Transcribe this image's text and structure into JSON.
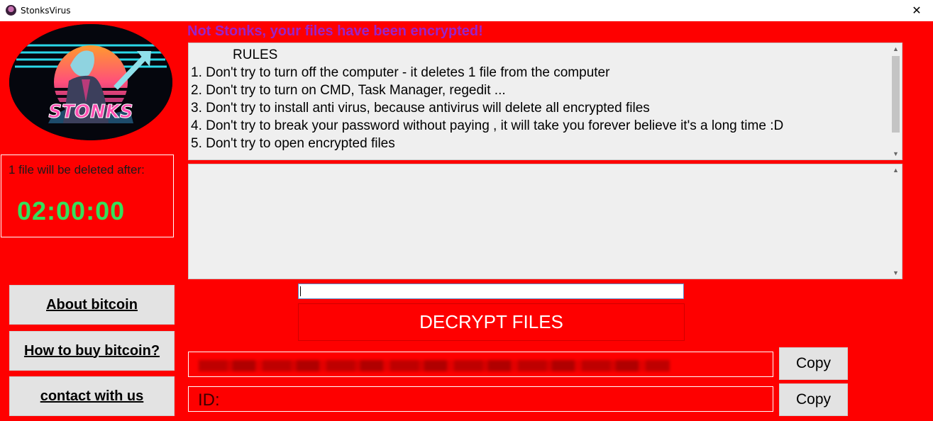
{
  "window": {
    "title": "StonksVirus",
    "close_glyph": "✕"
  },
  "logo": {
    "text": "STONKS",
    "icon": "stonks-logo"
  },
  "timer": {
    "label": "1 file will be deleted after:",
    "value": "02:00:00",
    "color": "#34e05a"
  },
  "sidebar": {
    "buttons": [
      {
        "label": "About bitcoin"
      },
      {
        "label": "How to buy bitcoin?"
      },
      {
        "label": "contact with us"
      }
    ]
  },
  "headline": "Not Stonks, your files have been encrypted!",
  "rules": {
    "title": "RULES",
    "items": [
      "1. Don't try to turn off the computer - it deletes 1 file from the computer",
      "2. Don't try to turn on CMD, Task Manager, regedit ...",
      "3. Don't try to install anti virus, because antivirus will delete all encrypted files",
      "4. Don't try to break your password without paying , it will take you forever believe it's a long time :D",
      "5. Don't try to open encrypted files"
    ]
  },
  "decrypt": {
    "button_label": "DECRYPT FILES",
    "key_value": ""
  },
  "wallet": {
    "copy_label": "Copy"
  },
  "id_field": {
    "label": "ID:",
    "copy_label": "Copy"
  },
  "colors": {
    "background": "#fe0000",
    "headline": "#9a23c9",
    "button_bg": "#e3e3e3"
  }
}
